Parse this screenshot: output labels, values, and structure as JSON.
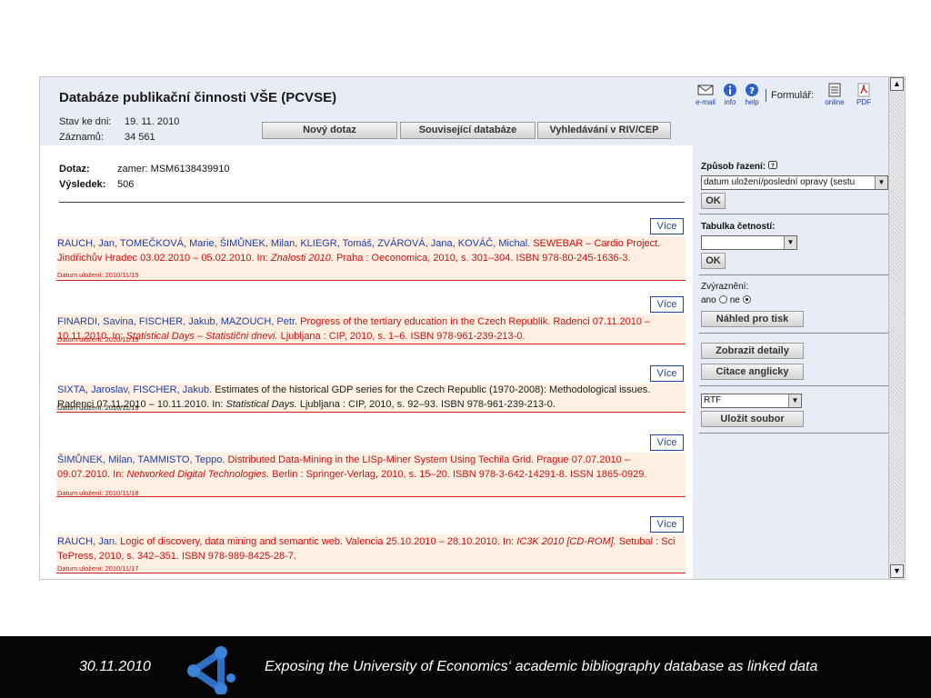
{
  "header": {
    "title": "Databáze publikační činnosti VŠE (PCVSE)",
    "as_of_label": "Stav ke dni:",
    "as_of_value": "19. 11. 2010",
    "records_label": "Záznamů:",
    "records_value": "34 561",
    "buttons": {
      "new_query": "Nový dotaz",
      "related_db": "Související databáze",
      "riv_search": "Vyhledávání v RIV/CEP"
    },
    "icons": {
      "email": "e-mail",
      "info": "info",
      "help": "help",
      "form_label": "Formulář:",
      "online": "online",
      "pdf": "PDF"
    }
  },
  "query": {
    "query_label": "Dotaz:",
    "query_value": "zamer: MSM6138439910",
    "result_label": "Výsledek:",
    "result_value": "506"
  },
  "more_label": "Více",
  "records": [
    {
      "authors": "RAUCH, Jan, TOMEČKOVÁ, Marie, ŠIMŮNEK, Milan, KLIEGR, Tomáš, ZVÁROVÁ, Jana, KOVÁČ, Michal.",
      "t1": " SEWEBAR – Cardio Project. Jindřichův Hradec 03.02.2010 – 05.02.2010. In: ",
      "it": "Znalosti 2010.",
      "t2": " Praha : Oeconomica, 2010, s. 301–304. ISBN 978-80-245-1636-3.",
      "date": "Datum uložení: 2010/11/19"
    },
    {
      "authors": "FINARDI, Savina, FISCHER, Jakub, MAZOUCH, Petr.",
      "t1": " Progress of the tertiary education in the Czech Republik. Radenci 07.11.2010 – 10.11.2010. In: ",
      "it": "Statistical Days – Statistični dnevi.",
      "t2": " Ljubljana : CIP, 2010, s. 1–6. ISBN 978-961-239-213-0.",
      "date": "Datum uložení: 2010/11/19"
    },
    {
      "authors": "SIXTA, Jaroslav, FISCHER, Jakub.",
      "t1": " Estimates of the historical GDP series for the Czech Republic (1970-2008): Methodological issues. Radenci 07.11.2010 – 10.11.2010. In: ",
      "it": "Statistical Days.",
      "t2": " Ljubljana : CIP, 2010, s. 92–93. ISBN 978-961-239-213-0.",
      "date": "Datum uložení: 2010/11/19"
    },
    {
      "authors": "ŠIMŮNEK, Milan, TAMMISTO, Teppo.",
      "t1": " Distributed Data-Mining in the LISp-Miner System Using Techila Grid. Prague 07.07.2010 – 09.07.2010. In: ",
      "it": "Networked Digital Technologies.",
      "t2": " Berlin : Springer-Verlag, 2010, s. 15–20. ISBN 978-3-642-14291-8. ISSN 1865-0929.",
      "date": "Datum uložení: 2010/11/18"
    },
    {
      "authors": "RAUCH, Jan.",
      "t1": " Logic of discovery, data mining and semantic web. Valencia 25.10.2010 – 28.10.2010. In: ",
      "it": "IC3K 2010 [CD-ROM].",
      "t2": " Setubal : Sci TePress, 2010, s. 342–351. ISBN 978-989-8425-28-7.",
      "date": "Datum uložení: 2010/11/17"
    }
  ],
  "sidebar": {
    "sort_label": "Způsob řazení:",
    "sort_value": "datum uložení/poslední opravy (sestu",
    "ok": "OK",
    "freq_label": "Tabulka četností:",
    "freq_value": "",
    "highlight_label": "Zvýraznění:",
    "yes": "ano",
    "no": "ne",
    "print_preview": "Náhled pro tisk",
    "show_details": "Zobrazit detaily",
    "cite_english": "Citace anglicky",
    "format_value": "RTF",
    "save_file": "Uložit soubor"
  },
  "footer": {
    "date": "30.11.2010",
    "title": "Exposing the University of Economics‘ academic bibliography database as linked data"
  }
}
